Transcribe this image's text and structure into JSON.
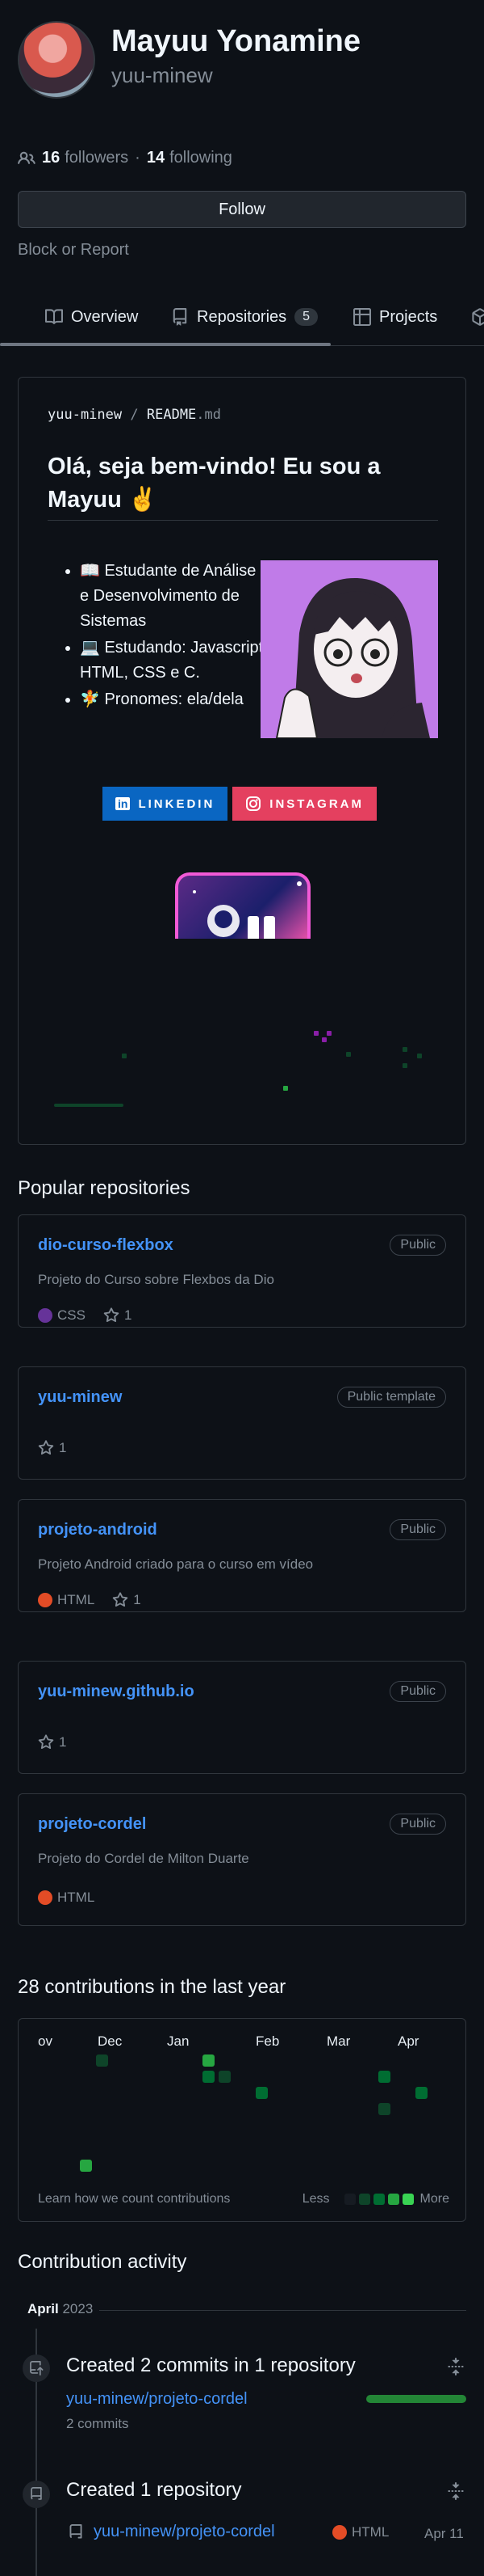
{
  "profile": {
    "name": "Mayuu Yonamine",
    "login": "yuu-minew",
    "followers_count": "16",
    "followers_label": "followers",
    "separator": "·",
    "following_count": "14",
    "following_label": "following",
    "follow_button": "Follow",
    "block_link": "Block or Report"
  },
  "tabs": [
    {
      "label": "Overview",
      "icon": "book-icon"
    },
    {
      "label": "Repositories",
      "icon": "repo-icon",
      "count": "5"
    },
    {
      "label": "Projects",
      "icon": "table-icon"
    }
  ],
  "readme": {
    "owner": "yuu-minew",
    "path_separator": "/",
    "file": "README",
    "ext": ".md",
    "title": "Olá, seja bem-vindo! Eu sou a Mayuu ✌️",
    "bullets": [
      "📖 Estudante de Análise e Desenvolvimento de Sistemas",
      "💻 Estudando: Javascript, HTML, CSS e C.",
      "🧚 Pronomes: ela/dela"
    ],
    "badges": [
      {
        "label": "LINKEDIN",
        "color": "#0a66c2",
        "icon": "linkedin-icon",
        "logo_text": "in"
      },
      {
        "label": "INSTAGRAM",
        "color": "#e4405f",
        "icon": "instagram-icon"
      }
    ]
  },
  "popular": {
    "title": "Popular repositories",
    "repos": [
      {
        "name": "dio-curso-flexbox",
        "visibility": "Public",
        "description": "Projeto do Curso sobre Flexbos da Dio",
        "language": "CSS",
        "lang_color": "#663399",
        "stars": "1"
      },
      {
        "name": "yuu-minew",
        "visibility": "Public template",
        "description": "",
        "language": "",
        "lang_color": "",
        "stars": "1"
      },
      {
        "name": "projeto-android",
        "visibility": "Public",
        "description": "Projeto Android criado para o curso em vídeo",
        "language": "HTML",
        "lang_color": "#e34c26",
        "stars": "1"
      },
      {
        "name": "yuu-minew.github.io",
        "visibility": "Public",
        "description": "",
        "language": "",
        "lang_color": "",
        "stars": "1"
      },
      {
        "name": "projeto-cordel",
        "visibility": "Public",
        "description": "Projeto do Cordel de Milton Duarte",
        "language": "HTML",
        "lang_color": "#e34c26",
        "stars": ""
      }
    ]
  },
  "contributions": {
    "title": "28 contributions in the last year",
    "months": [
      "ov",
      "Dec",
      "Jan",
      "Feb",
      "Mar",
      "Apr"
    ],
    "learn_link": "Learn how we count contributions",
    "less": "Less",
    "more": "More",
    "legend_colors": [
      "#161b22",
      "#0e4429",
      "#006d32",
      "#26a641",
      "#39d353"
    ]
  },
  "activity": {
    "title": "Contribution activity",
    "month": "April",
    "year": "2023",
    "items": [
      {
        "title": "Created 2 commits in 1 repository",
        "repo": "yuu-minew/projeto-cordel",
        "detail": "2 commits"
      },
      {
        "title": "Created 1 repository",
        "repo": "yuu-minew/projeto-cordel",
        "language": "HTML",
        "lang_color": "#e34c26",
        "date": "Apr 11"
      }
    ]
  }
}
